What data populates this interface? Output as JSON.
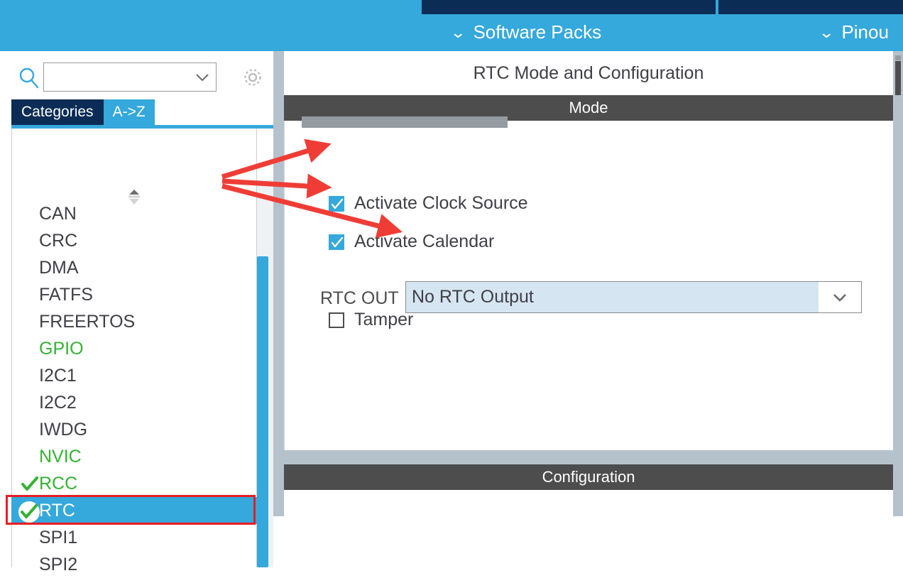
{
  "topbar": {
    "menu_items": [
      {
        "label": "Software Packs",
        "icon": "chevron-down-icon"
      },
      {
        "label": "Pinou",
        "icon": "chevron-down-icon"
      }
    ],
    "accent_color": "#35a8dc",
    "tab_color": "#0b2c55"
  },
  "sidebar": {
    "search": {
      "value": "",
      "placeholder": "",
      "icon": "search-icon"
    },
    "settings_icon": "gear-icon",
    "tabs": [
      {
        "label": "Categories",
        "active": true
      },
      {
        "label": "A->Z",
        "active": false
      }
    ],
    "sorter_icon": "sort-collapse-icon",
    "items": [
      {
        "label": "CAN",
        "state": "default",
        "check": "none"
      },
      {
        "label": "CRC",
        "state": "default",
        "check": "none"
      },
      {
        "label": "DMA",
        "state": "default",
        "check": "none"
      },
      {
        "label": "FATFS",
        "state": "default",
        "check": "none"
      },
      {
        "label": "FREERTOS",
        "state": "default",
        "check": "none"
      },
      {
        "label": "GPIO",
        "state": "configured",
        "check": "none"
      },
      {
        "label": "I2C1",
        "state": "default",
        "check": "none"
      },
      {
        "label": "I2C2",
        "state": "default",
        "check": "none"
      },
      {
        "label": "IWDG",
        "state": "default",
        "check": "none"
      },
      {
        "label": "NVIC",
        "state": "configured",
        "check": "none"
      },
      {
        "label": "RCC",
        "state": "configured",
        "check": "tick"
      },
      {
        "label": "RTC",
        "state": "selected",
        "check": "tick-circle"
      },
      {
        "label": "SPI1",
        "state": "default",
        "check": "none"
      },
      {
        "label": "SPI2",
        "state": "default",
        "check": "none"
      }
    ],
    "colors": {
      "configured": "#34b233",
      "selected_bg": "#35a8dc",
      "highlight_box": "#e81e25"
    }
  },
  "content": {
    "panel_title": "RTC Mode and Configuration",
    "mode_section": {
      "header": "Mode",
      "checkboxes": [
        {
          "label": "Activate Clock Source",
          "checked": true
        },
        {
          "label": "Activate Calendar",
          "checked": true
        },
        {
          "label": "Tamper",
          "checked": false
        }
      ],
      "rtc_out": {
        "label": "RTC OUT",
        "value": "No RTC Output",
        "icon": "chevron-down-icon"
      }
    },
    "config_section": {
      "header": "Configuration"
    }
  },
  "annotations": {
    "arrow_color": "#ef3d36",
    "count": 3
  }
}
